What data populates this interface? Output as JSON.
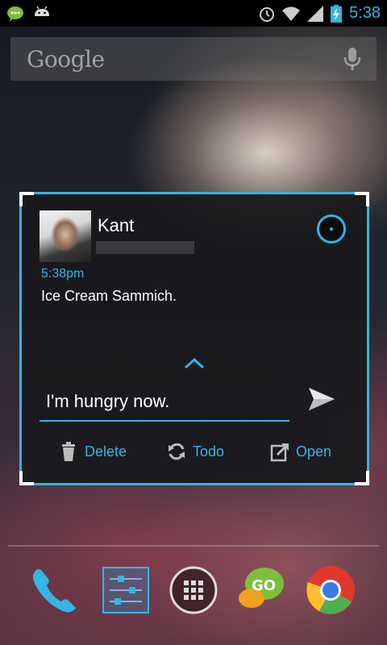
{
  "status_bar": {
    "time": "5:38",
    "left_icons": [
      "chat-notification-icon",
      "android-icon"
    ],
    "right_icons": [
      "alarm-icon",
      "wifi-icon",
      "signal-icon",
      "battery-charging-icon"
    ]
  },
  "search": {
    "placeholder": "Google",
    "icons": [
      "mic-icon"
    ]
  },
  "widget": {
    "contact_name": "Kant",
    "time": "5:38pm",
    "message": "Ice Cream Sammich.",
    "reply_text": "I'm hungry now.",
    "actions": [
      {
        "label": "Delete",
        "icon": "trash-icon"
      },
      {
        "label": "Todo",
        "icon": "refresh-icon"
      },
      {
        "label": "Open",
        "icon": "open-external-icon"
      }
    ],
    "accent": "#33b5e5"
  },
  "dock": {
    "apps": [
      "phone-icon",
      "settings-sliders-icon",
      "app-drawer-icon",
      "go-sms-icon",
      "chrome-icon"
    ]
  }
}
